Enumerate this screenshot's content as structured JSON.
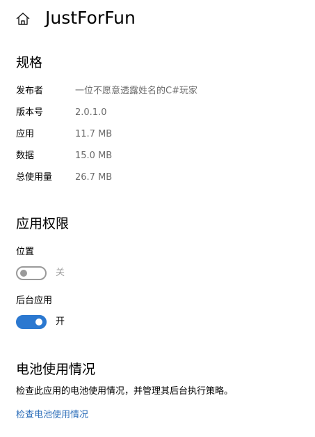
{
  "header": {
    "home_icon": "home-icon",
    "title": "JustForFun"
  },
  "specs": {
    "heading": "规格",
    "rows": [
      {
        "label": "发布者",
        "value": "一位不愿意透露姓名的C#玩家"
      },
      {
        "label": "版本号",
        "value": "2.0.1.0"
      },
      {
        "label": "应用",
        "value": "11.7 MB"
      },
      {
        "label": "数据",
        "value": "15.0 MB"
      },
      {
        "label": "总使用量",
        "value": "26.7 MB"
      }
    ]
  },
  "permissions": {
    "heading": "应用权限",
    "items": [
      {
        "label": "位置",
        "state": "关",
        "enabled": false
      },
      {
        "label": "后台应用",
        "state": "开",
        "enabled": true
      }
    ]
  },
  "battery": {
    "heading": "电池使用情况",
    "description": "检查此应用的电池使用情况，并管理其后台执行策略。",
    "link": "检查电池使用情况"
  },
  "colors": {
    "accent": "#2b78d0",
    "link": "#2a6cb8",
    "secondary_text": "#6b6b6b",
    "toggle_off": "#9a9a9a"
  }
}
